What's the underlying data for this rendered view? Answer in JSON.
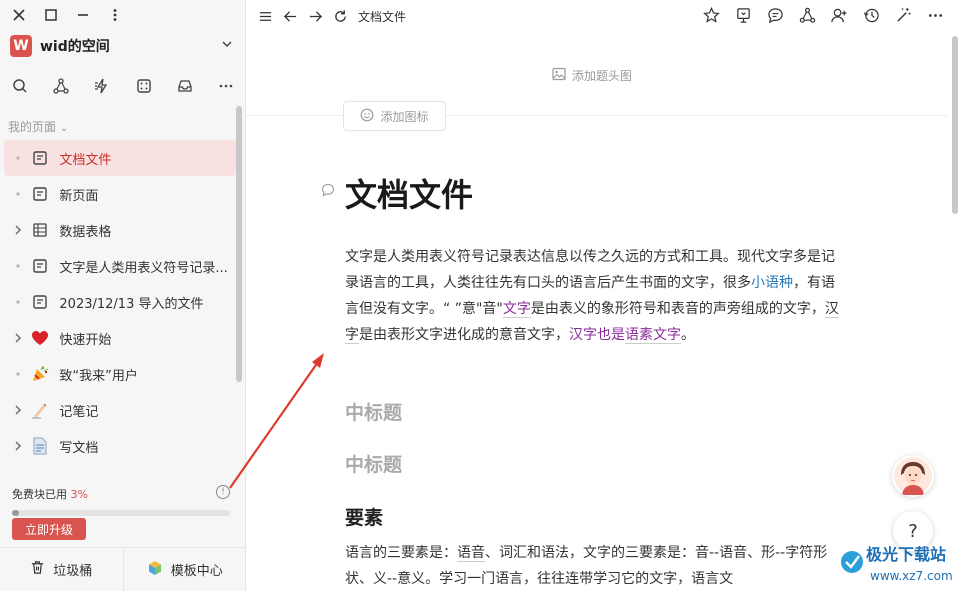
{
  "sidebar": {
    "space_logo": "W",
    "space_name": "wid的空间",
    "section_label": "我的页面",
    "items": [
      {
        "label": "文档文件",
        "icon": "document-icon",
        "lead": "dot",
        "active": true
      },
      {
        "label": "新页面",
        "icon": "document-icon",
        "lead": "dot"
      },
      {
        "label": "数据表格",
        "icon": "table-icon",
        "lead": "arrow"
      },
      {
        "label": "文字是人类用表义符号记录...",
        "icon": "document-icon",
        "lead": "dot"
      },
      {
        "label": "2023/12/13 导入的文件",
        "icon": "document-icon",
        "lead": "dot"
      },
      {
        "label": "快速开始",
        "icon": "heart-icon",
        "lead": "arrow"
      },
      {
        "label": "致“我来”用户",
        "icon": "party-popper-icon",
        "lead": "dot"
      },
      {
        "label": "记笔记",
        "icon": "writing-hand-icon",
        "lead": "arrow"
      },
      {
        "label": "写文档",
        "icon": "page-icon",
        "lead": "arrow"
      }
    ],
    "quota_label": "免费块已用",
    "quota_percent": "3%",
    "quota_fraction": 0.03,
    "upgrade_label": "立即升级",
    "footer": {
      "trash": "垃圾桶",
      "templates": "模板中心"
    }
  },
  "topbar": {
    "doc_title": "文档文件"
  },
  "doc": {
    "add_cover": "添加题头图",
    "add_icon": "添加图标",
    "title": "文档文件",
    "para1_parts": {
      "p1": "文字是人类用表义符号记录表达信息以传之久远的方式和工具。现代文字多是记录语言的工具，人类往往先有口头的语言后产生书面的文字，很多",
      "link1": "小语种",
      "p2": "，有语言但没有文字。“ ”意\"音\"",
      "link2": "文字",
      "p3": "是由表义的象形符号和表音的声旁组成的文字，",
      "link3": "汉字",
      "p4": "是由表形文字进化成的意音文字，",
      "link4": "汉字也是",
      "link5": "语素文字",
      "p5": "。"
    },
    "h2a": "中标题",
    "h2b": "中标题",
    "h2c": "要素",
    "para2_parts": {
      "p1": "语言的三要素是：",
      "link1": "语音",
      "p2": "、词汇和语法，文字的三要素是：音--语音、形--字符形状、义--意义。学习一门语言，往往连带学习它的文字，语言文"
    }
  },
  "help_label": "?",
  "watermark": {
    "title": "极光下载站",
    "url": "www.xz7.com"
  },
  "colors": {
    "accent": "#d9534f",
    "active_bg": "#f8e1e1",
    "link_blue": "#2a7ab8",
    "link_purple": "#8a2c9a",
    "arrow": "#e03a2e"
  }
}
